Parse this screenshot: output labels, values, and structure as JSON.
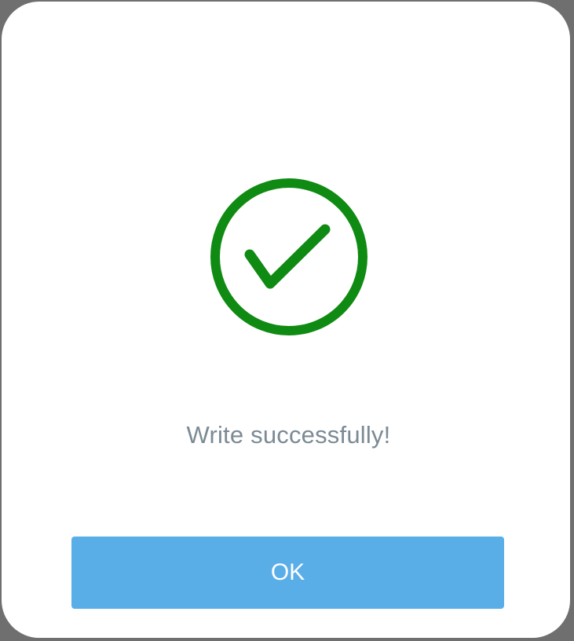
{
  "dialog": {
    "icon": "check-circle-icon",
    "message": "Write successfully!",
    "ok_label": "OK"
  },
  "colors": {
    "success": "#0f8a12",
    "button": "#5aaee8",
    "message": "#7b8a95"
  }
}
